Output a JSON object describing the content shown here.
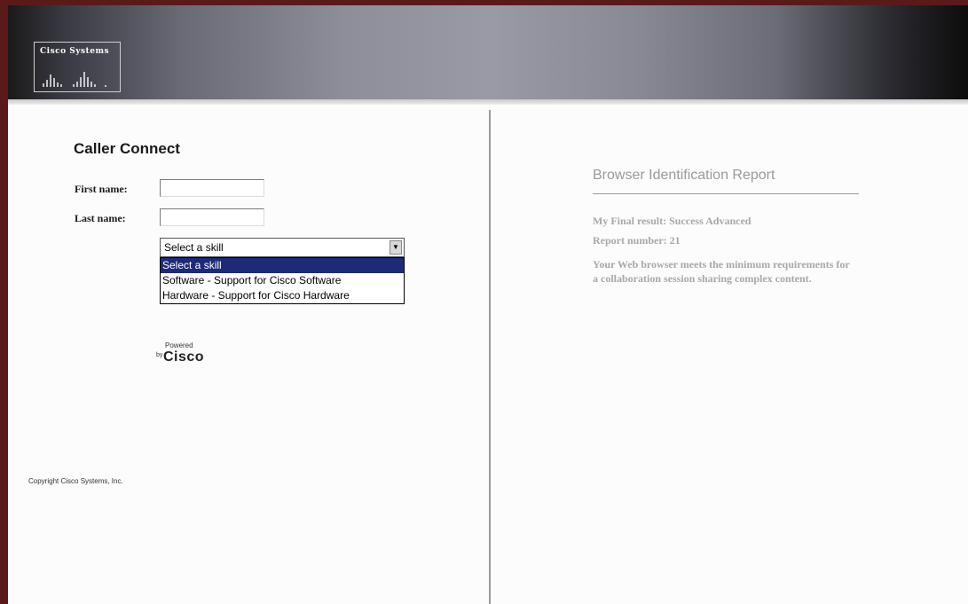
{
  "header": {
    "logo_text": "Cisco Systems"
  },
  "form": {
    "title": "Caller Connect",
    "first_name_label": "First name:",
    "first_name_value": "",
    "last_name_label": "Last name:",
    "last_name_value": "",
    "skill_select": {
      "value": "Select a skill",
      "options": [
        "Select a skill",
        "Software - Support for Cisco Software",
        "Hardware - Support for Cisco Hardware"
      ],
      "highlighted_index": 0
    },
    "powered_small": "Powered",
    "powered_by": "by",
    "powered_brand": "Cisco",
    "copyright": "Copyright Cisco Systems, Inc."
  },
  "report": {
    "title": "Browser Identification Report",
    "final_result": "My Final result: Success Advanced",
    "report_number": "Report number: 21",
    "message": "Your Web browser meets the minimum requirements for a collaboration session sharing complex content."
  },
  "colors": {
    "frame": "#5a1a1a",
    "highlight": "#1c2a78",
    "report_text": "#a8a8a8"
  }
}
